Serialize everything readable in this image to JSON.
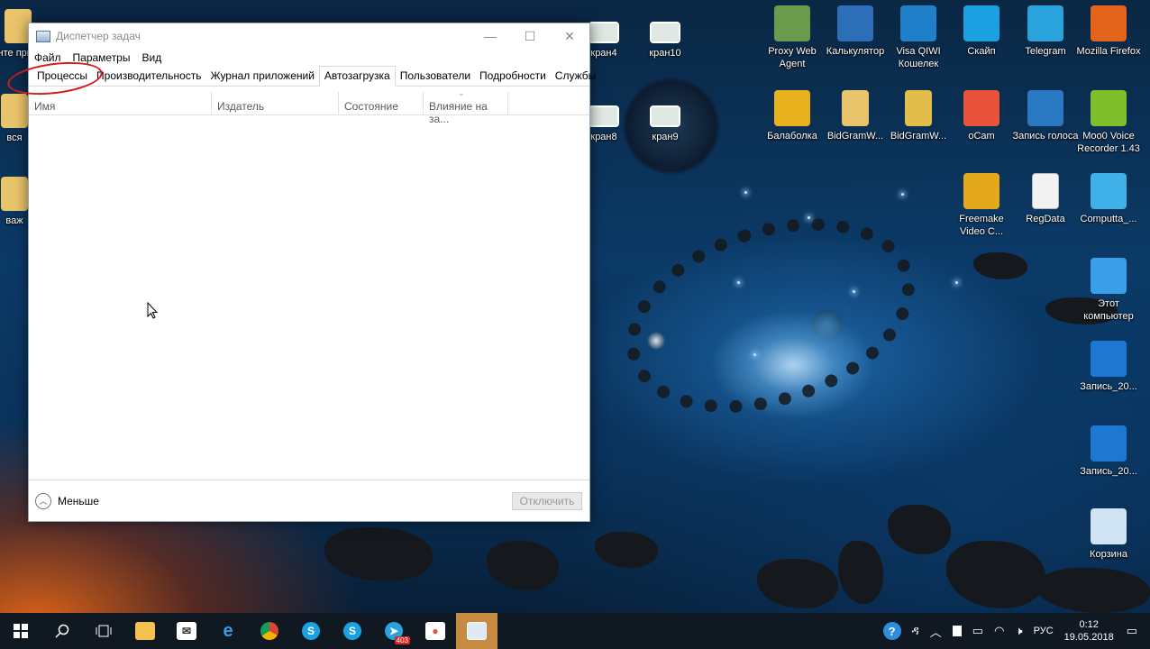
{
  "window": {
    "title": "Диспетчер задач",
    "minimize_glyph": "—",
    "maximize_glyph": "☐",
    "close_glyph": "✕"
  },
  "menu": [
    "Файл",
    "Параметры",
    "Вид"
  ],
  "tabs": [
    "Процессы",
    "Производительность",
    "Журнал приложений",
    "Автозагрузка",
    "Пользователи",
    "Подробности",
    "Службы"
  ],
  "active_tab": "Автозагрузка",
  "columns": [
    "Имя",
    "Издатель",
    "Состояние",
    "Влияние на за..."
  ],
  "footer": {
    "less_label": "Меньше",
    "disable_button": "Отключить"
  },
  "desktop_left": [
    "инте прило",
    "вся",
    "важ"
  ],
  "desktop_mid": [
    "кран4",
    "кран10",
    "кран8",
    "кран9"
  ],
  "desktop_right": [
    {
      "label": "Proxy Web Agent",
      "icon": "monitor-icon",
      "color": "#6a9a4c"
    },
    {
      "label": "Калькулятор",
      "icon": "calculator-icon",
      "color": "#2c6fb8"
    },
    {
      "label": "Visa QIWI Кошелек",
      "icon": "qiwi-icon",
      "color": "#1f7fc8"
    },
    {
      "label": "Скайп",
      "icon": "skype-icon",
      "color": "#1ba1e2"
    },
    {
      "label": "Telegram",
      "icon": "telegram-icon",
      "color": "#2aa3dd"
    },
    {
      "label": "Mozilla Firefox",
      "icon": "firefox-icon",
      "color": "#e5641b"
    },
    {
      "label": "Балаболка",
      "icon": "smiley-icon",
      "color": "#e8b21e"
    },
    {
      "label": "BidGramW...",
      "icon": "folder-icon",
      "color": "#e9c46a"
    },
    {
      "label": "BidGramW...",
      "icon": "zip-folder-icon",
      "color": "#e3bd4c"
    },
    {
      "label": "oCam",
      "icon": "ocam-icon",
      "color": "#e9533b"
    },
    {
      "label": "Запись голоса",
      "icon": "voice-recorder-icon",
      "color": "#2b78c2"
    },
    {
      "label": "Moo0 Voice Recorder 1.43",
      "icon": "moo0-icon",
      "color": "#7fbf2b"
    },
    {
      "label": "Freemake Video C...",
      "icon": "freemake-icon",
      "color": "#e3a81c"
    },
    {
      "label": "RegData",
      "icon": "document-icon",
      "color": "#f2f2f2"
    },
    {
      "label": "Computta_...",
      "icon": "computta-icon",
      "color": "#3fb1e8"
    },
    {
      "label": "Этот компьютер",
      "icon": "this-pc-icon",
      "color": "#3a9ee8"
    },
    {
      "label": "Запись_20...",
      "icon": "video-file-icon",
      "color": "#1e78d2"
    },
    {
      "label": "Запись_20...",
      "icon": "video-file-icon",
      "color": "#1e78d2"
    },
    {
      "label": "Корзина",
      "icon": "recycle-bin-icon",
      "color": "#cfe3f2"
    }
  ],
  "taskbar": {
    "telegram_badge": "403",
    "language": "РУС",
    "time": "0:12",
    "date": "19.05.2018"
  }
}
